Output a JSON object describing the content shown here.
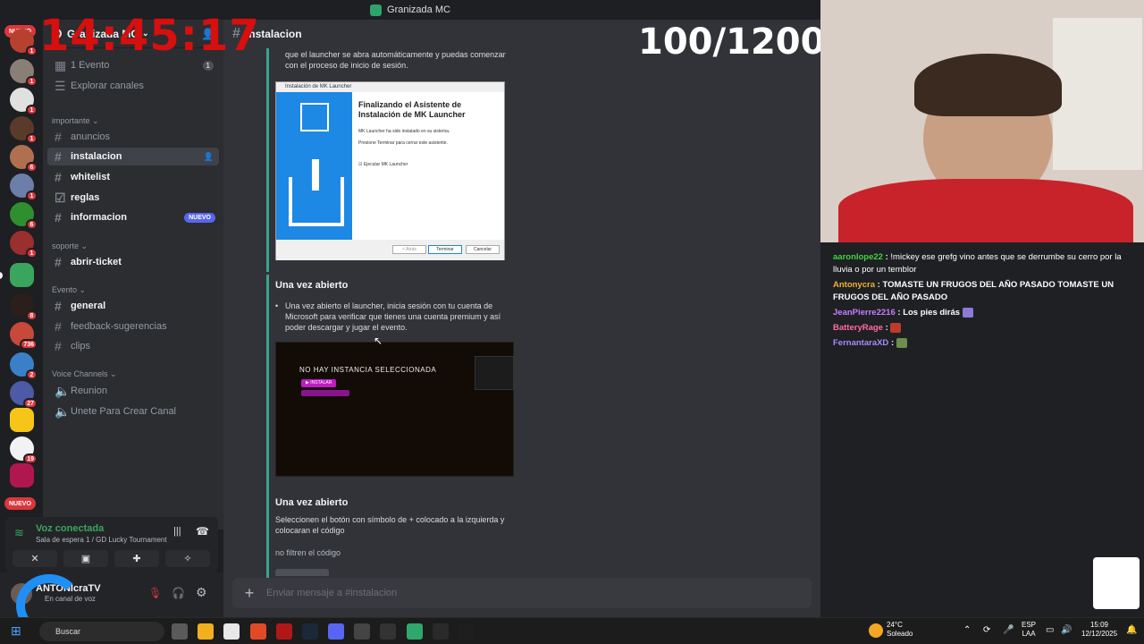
{
  "titlebar": {
    "server": "Granizada MC"
  },
  "overlay": {
    "timer": "14:45:17",
    "counter": "100/1200"
  },
  "rail": {
    "nuevo_top": "NUEVO",
    "nuevo_bottom": "NUEVO",
    "badges": [
      "1",
      "1",
      "1",
      "1",
      "6",
      "1",
      "6",
      "1",
      "8",
      "736",
      "2",
      "27",
      "19"
    ]
  },
  "server": {
    "name": "Granizada MC"
  },
  "sidebar": {
    "event": {
      "label": "1 Evento",
      "count": "1"
    },
    "browse": "Explorar canales",
    "cat_importante": "importante",
    "cat_soporte": "soporte",
    "cat_evento": "Evento",
    "cat_voice": "Voice Channels",
    "channels": {
      "anuncios": "anuncios",
      "instalacion": "instalacion",
      "whitelist": "whitelist",
      "reglas": "reglas",
      "informacion": "informacion",
      "informacion_badge": "NUEVO",
      "abrir_ticket": "abrir-ticket",
      "general": "general",
      "feedback": "feedback-sugerencias",
      "clips": "clips",
      "reunion": "Reunion",
      "unete": "Unete Para Crear Canal"
    }
  },
  "voice": {
    "status": "Voz conectada",
    "location": "Sala de espera 1 / GD Lucky Tournament"
  },
  "user": {
    "name": "ANTONIcraTV",
    "status": "En canal de voz"
  },
  "chat": {
    "channel": "instalacion",
    "msg1": "que el launcher se abra automáticamente y puedas comenzar con el proceso de inicio de sesión.",
    "embed2_title": "Una vez abierto",
    "embed2_bullet": "Una vez abierto el launcher, inicia sesión con tu cuenta de Microsoft para verificar que tienes una cuenta premium y así poder descargar y jugar el evento.",
    "embed3_title": "Una vez abierto",
    "embed3_text": "Seleccionen el botón con símbolo de + colocado a la izquierda y colocaran el código",
    "embed3_note": "no filtren el código",
    "placeholder": "Enviar mensaje a #instalacion"
  },
  "installer": {
    "window_title": "Instalación de MK Launcher",
    "heading": "Finalizando el Asistente de Instalación de MK Launcher",
    "line1": "MK Launcher ha sido instalado en su sistema.",
    "line2": "Presione Terminar para cerrar este asistente.",
    "checkbox": "Ejecutar MK Launcher",
    "back": "< Atrás",
    "finish": "Terminar",
    "cancel": "Cancelar"
  },
  "launcher": {
    "message": "NO HAY INSTANCIA SELECCIONADA",
    "install": "▶ INSTALAR"
  },
  "stream_chat": [
    {
      "user": "aaronlope22",
      "color": "#3fd63f",
      "text": "!mickey ese grefg vino antes que se derrumbe su cerro por la lluvia o por un temblor"
    },
    {
      "user": "Antonycra",
      "color": "#f0b232",
      "text": "TOMASTE UN FRUGOS DEL AÑO PASADO  TOMASTE UN FRUGOS DEL AÑO PASADO"
    },
    {
      "user": "JeanPierre2216",
      "color": "#c77dff",
      "text": "Los pies dirás"
    },
    {
      "user": "BatteryRage",
      "color": "#ff6b9d",
      "text": ""
    },
    {
      "user": "FernantaraXD",
      "color": "#a78bfa",
      "text": ""
    }
  ],
  "taskbar": {
    "search": "Buscar",
    "weather_temp": "24°C",
    "weather_desc": "Soleado",
    "lang1": "ESP",
    "lang2": "LAA",
    "time": "15:09",
    "date": "12/12/2025"
  }
}
